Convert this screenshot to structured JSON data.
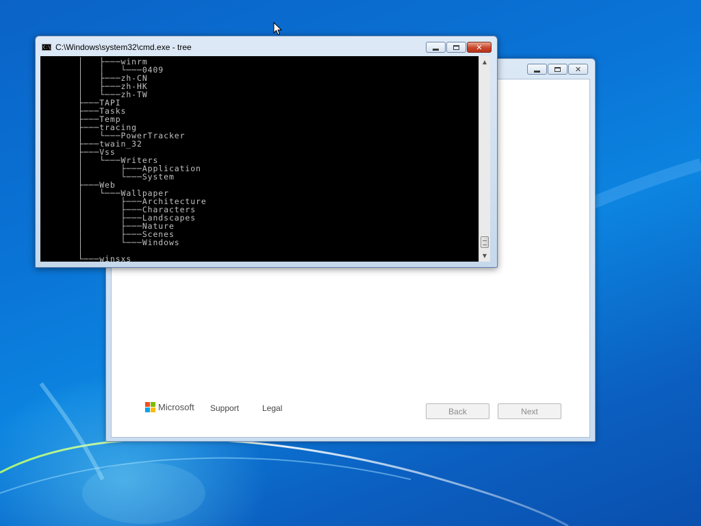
{
  "desktop": {
    "wallpaper": "windows-7-default-blue"
  },
  "setup_window": {
    "buttons": {
      "minimize_icon": "minimize-icon",
      "maximize_icon": "maximize-icon",
      "close_icon": "close-icon"
    },
    "footer": {
      "brand": "Microsoft",
      "logo_colors": [
        "#f25022",
        "#7fba00",
        "#00a4ef",
        "#ffb900"
      ],
      "support_label": "Support",
      "legal_label": "Legal",
      "back_label": "Back",
      "next_label": "Next"
    }
  },
  "cmd_window": {
    "title": "C:\\Windows\\system32\\cmd.exe - tree",
    "icon": "C:\\",
    "buttons": {
      "minimize_icon": "minimize-icon",
      "maximize_icon": "maximize-icon",
      "close_icon": "close-icon"
    },
    "console_lines": [
      "      │   ├───winrm",
      "      │   │   └───0409",
      "      │   ├───zh-CN",
      "      │   ├───zh-HK",
      "      │   └───zh-TW",
      "      ├───TAPI",
      "      ├───Tasks",
      "      ├───Temp",
      "      ├───tracing",
      "      │   └───PowerTracker",
      "      ├───twain_32",
      "      ├───Vss",
      "      │   └───Writers",
      "      │       ├───Application",
      "      │       └───System",
      "      ├───Web",
      "      │   └───Wallpaper",
      "      │       ├───Architecture",
      "      │       ├───Characters",
      "      │       ├───Landscapes",
      "      │       ├───Nature",
      "      │       ├───Scenes",
      "      │       └───Windows",
      "      │",
      "      └───winsxs"
    ],
    "scrollbar": {
      "up_icon": "scroll-up-arrow-icon",
      "down_icon": "scroll-down-arrow-icon"
    }
  },
  "cursor": {
    "icon": "mouse-pointer-icon"
  }
}
